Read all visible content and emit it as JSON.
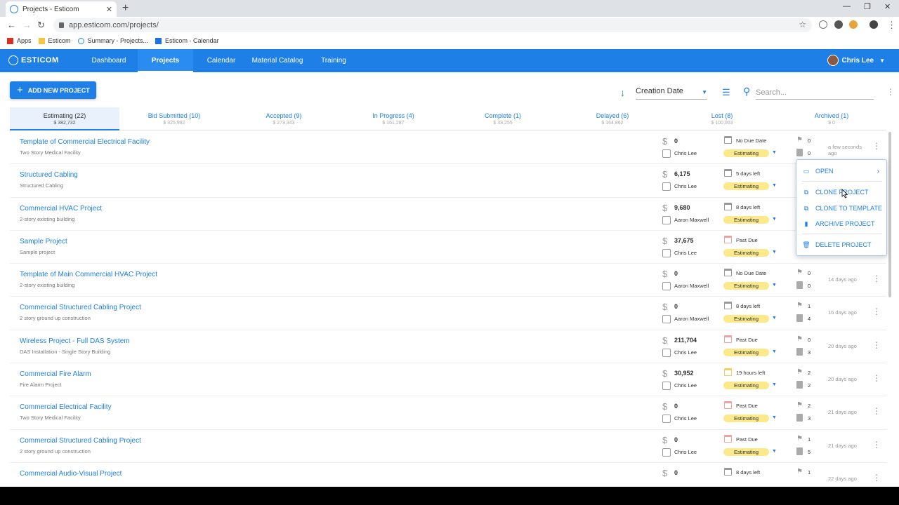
{
  "browser": {
    "tab_title": "Projects - Esticom",
    "url": "app.esticom.com/projects/",
    "bookmarks": [
      "Apps",
      "Esticom",
      "Summary - Projects...",
      "Esticom - Calendar"
    ]
  },
  "nav": {
    "logo": "ESTICOM",
    "links": [
      "Dashboard",
      "Projects",
      "Calendar",
      "Material Catalog",
      "Training"
    ],
    "user": "Chris Lee"
  },
  "toolbar": {
    "add_label": "ADD NEW PROJECT",
    "sort_value": "Creation Date",
    "search_placeholder": "Search..."
  },
  "status_tabs": [
    {
      "label": "Estimating (22)",
      "amount": "$ 382,732"
    },
    {
      "label": "Bid Submitted (10)",
      "amount": "$ 325,982"
    },
    {
      "label": "Accepted (9)",
      "amount": "$ 273,343"
    },
    {
      "label": "In Progress (4)",
      "amount": "$ 161,287"
    },
    {
      "label": "Complete (1)",
      "amount": "$ 33,255"
    },
    {
      "label": "Delayed (6)",
      "amount": "$ 164,862"
    },
    {
      "label": "Lost (8)",
      "amount": "$ 100,003"
    },
    {
      "label": "Archived (1)",
      "amount": "$ 0"
    }
  ],
  "projects": [
    {
      "name": "Template of Commercial Electrical Facility",
      "desc": "Two Story Medical Facility",
      "amount": "0",
      "owner": "Chris Lee",
      "due": "No Due Date",
      "status": "Estimating",
      "flags": "0",
      "docs": "0",
      "time": "a few seconds ago"
    },
    {
      "name": "Structured Cabling",
      "desc": "Structured Cabling",
      "amount": "6,175",
      "owner": "Chris Lee",
      "due": "5 days left",
      "status": "Estimating",
      "flags": "",
      "docs": "",
      "time": ""
    },
    {
      "name": "Commercial HVAC Project",
      "desc": "2-story existing building",
      "amount": "9,680",
      "owner": "Aaron Maxwell",
      "due": "8 days left",
      "status": "Estimating",
      "flags": "",
      "docs": "",
      "time": ""
    },
    {
      "name": "Sample Project",
      "desc": "Sample project",
      "amount": "37,675",
      "owner": "Chris Lee",
      "due": "Past Due",
      "status": "Estimating",
      "flags": "",
      "docs": "",
      "time": ""
    },
    {
      "name": "Template of Main Commercial HVAC Project",
      "desc": "2-story existing building",
      "amount": "0",
      "owner": "Aaron Maxwell",
      "due": "No Due Date",
      "status": "Estimating",
      "flags": "0",
      "docs": "0",
      "time": "14 days ago"
    },
    {
      "name": "Commercial Structured Cabling Project",
      "desc": "2 story ground up construction",
      "amount": "0",
      "owner": "Aaron Maxwell",
      "due": "8 days left",
      "status": "Estimating",
      "flags": "1",
      "docs": "4",
      "time": "16 days ago"
    },
    {
      "name": "Wireless Project - Full DAS System",
      "desc": "DAS Installation - Single Story Building",
      "amount": "211,704",
      "owner": "Chris Lee",
      "due": "Past Due",
      "status": "Estimating",
      "flags": "0",
      "docs": "3",
      "time": "20 days ago"
    },
    {
      "name": "Commercial Fire Alarm",
      "desc": "Fire Alarm Project",
      "amount": "30,952",
      "owner": "Chris Lee",
      "due": "19 hours left",
      "status": "Estimating",
      "flags": "2",
      "docs": "2",
      "time": "20 days ago"
    },
    {
      "name": "Commercial Electrical Facility",
      "desc": "Two Story Medical Facility",
      "amount": "0",
      "owner": "Chris Lee",
      "due": "Past Due",
      "status": "Estimating",
      "flags": "2",
      "docs": "3",
      "time": "21 days ago"
    },
    {
      "name": "Commercial Structured Cabling Project",
      "desc": "2 story ground up construction",
      "amount": "0",
      "owner": "Chris Lee",
      "due": "Past Due",
      "status": "Estimating",
      "flags": "1",
      "docs": "5",
      "time": "21 days ago"
    },
    {
      "name": "Commercial Audio-Visual Project",
      "desc": "",
      "amount": "0",
      "owner": "",
      "due": "8 days left",
      "status": "",
      "flags": "1",
      "docs": "",
      "time": "22 days ago"
    }
  ],
  "context_menu": {
    "items": [
      "OPEN",
      "CLONE PROJECT",
      "CLONE TO TEMPLATE",
      "ARCHIVE PROJECT",
      "DELETE PROJECT"
    ]
  },
  "colors": {
    "brand": "#1e7fe6",
    "status_estimating": "#fbe98c",
    "overdue": "#f2a0a0"
  }
}
